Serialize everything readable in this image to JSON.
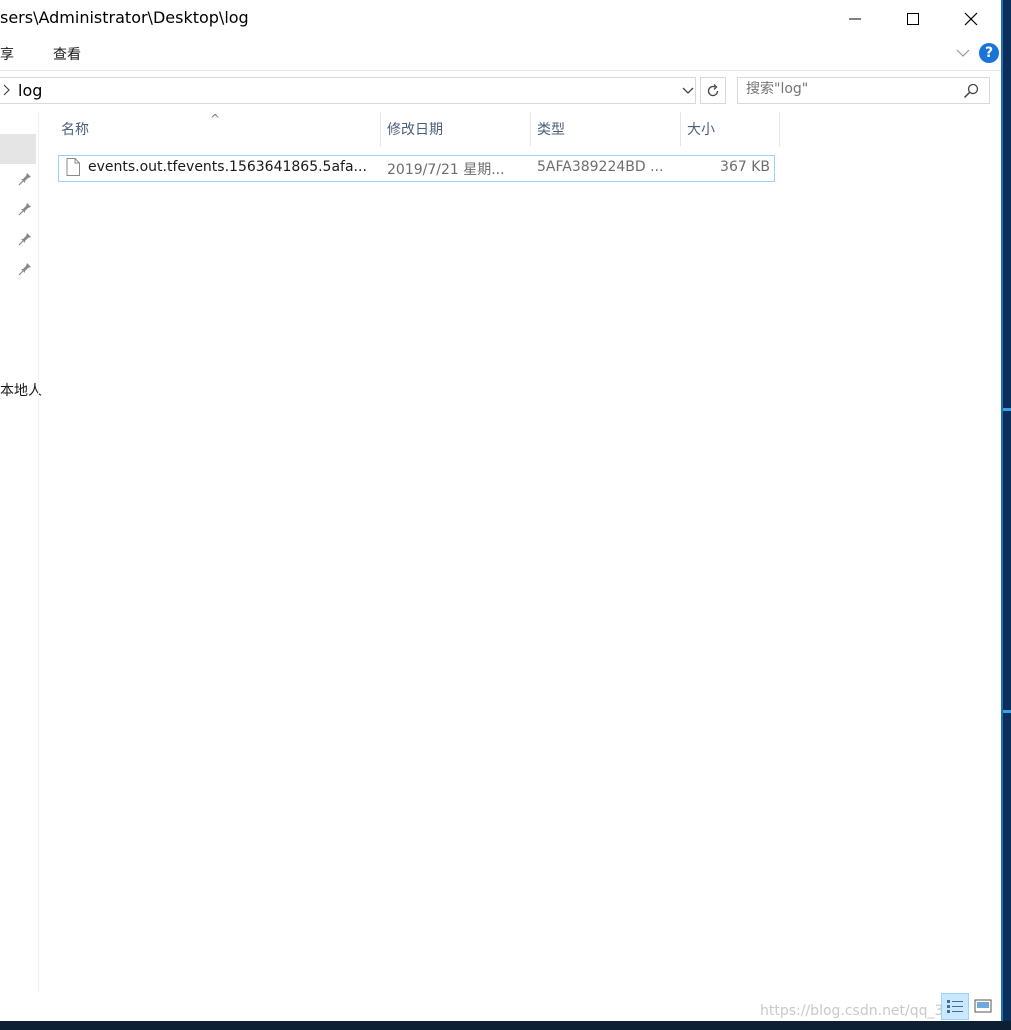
{
  "window": {
    "title": "sers\\Administrator\\Desktop\\log",
    "minimize_icon": "minimize-icon",
    "maximize_icon": "maximize-icon",
    "close_icon": "close-icon"
  },
  "ribbon": {
    "tabs": [
      {
        "label": "享"
      },
      {
        "label": "查看"
      }
    ],
    "help_label": "?"
  },
  "address_bar": {
    "path": "log"
  },
  "search": {
    "placeholder": "搜索\"log\""
  },
  "nav_pane": {
    "partial_label": "本地人"
  },
  "columns": [
    {
      "label": "名称"
    },
    {
      "label": "修改日期"
    },
    {
      "label": "类型"
    },
    {
      "label": "大小"
    }
  ],
  "files": [
    {
      "name": "events.out.tfevents.1563641865.5afa...",
      "modified": "2019/7/21 星期...",
      "type": "5AFA389224BD ...",
      "size": "367 KB"
    }
  ],
  "watermark": "https://blog.csdn.net/qq_3",
  "colors": {
    "accent": "#1a73d9",
    "selection_border": "#99d1ff",
    "selection_fill": "#cce8ff",
    "header_text": "#4c607a"
  }
}
